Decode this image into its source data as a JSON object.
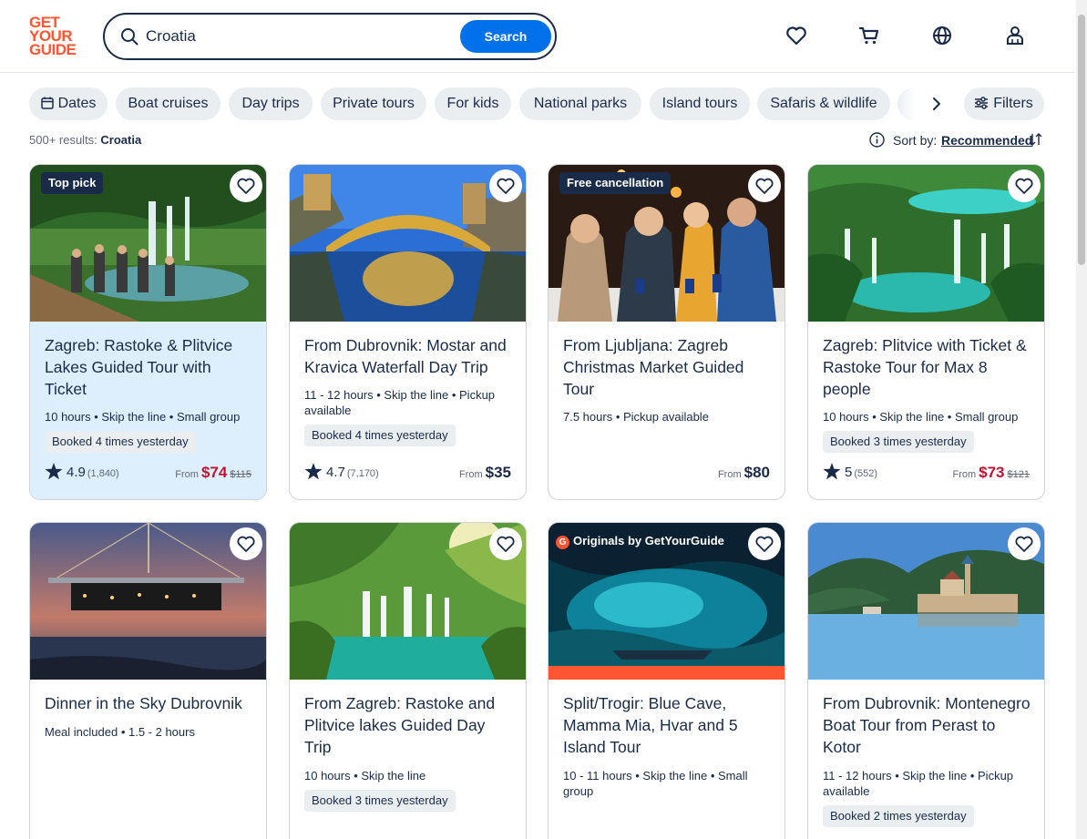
{
  "header": {
    "logo": [
      "GET",
      "YOUR",
      "GUIDE"
    ],
    "search_value": "Croatia",
    "search_button": "Search",
    "icons": [
      "heart-icon",
      "cart-icon",
      "globe-icon",
      "account-icon"
    ]
  },
  "chips": {
    "items": [
      "Dates",
      "Boat cruises",
      "Day trips",
      "Private tours",
      "For kids",
      "National parks",
      "Island tours",
      "Safaris & wildlife"
    ],
    "filters_label": "Filters"
  },
  "results": {
    "count": "500+ results:",
    "query": "Croatia",
    "sort_label": "Sort by:",
    "sort_value": "Recommended"
  },
  "colors": {
    "brand": "#ff5533",
    "primary": "#0071eb",
    "text": "#1a2b49",
    "sale": "#c4112f",
    "highlight": "#ddeefc"
  },
  "cards": [
    {
      "badge": "Top pick",
      "title": "Zagreb: Rastoke & Plitvice Lakes Guided Tour with Ticket",
      "meta": "10 hours • Skip the line • Small group",
      "booked": "Booked 4 times yesterday",
      "rating": "4.9",
      "reviews": "(1,840)",
      "price_prefix": "From",
      "price": "$74",
      "old_price": "$115"
    },
    {
      "title": "From Dubrovnik: Mostar and Kravica Waterfall Day Trip",
      "meta": "11 - 12 hours • Skip the line • Pickup available",
      "booked": "Booked 4 times yesterday",
      "rating": "4.7",
      "reviews": "(7,170)",
      "price_prefix": "From",
      "price": "$35"
    },
    {
      "badge": "Free cancellation",
      "title": "From Ljubljana: Zagreb Christmas Market Guided Tour",
      "meta": "7.5 hours • Pickup available",
      "price_prefix": "From",
      "price": "$80"
    },
    {
      "title": "Zagreb: Plitvice with Ticket & Rastoke Tour for Max 8 people",
      "meta": "10 hours • Skip the line • Small group",
      "booked": "Booked 3 times yesterday",
      "rating": "5",
      "reviews": "(552)",
      "price_prefix": "From",
      "price": "$73",
      "old_price": "$121"
    },
    {
      "title": "Dinner in the Sky Dubrovnik",
      "meta": "Meal included • 1.5 - 2 hours"
    },
    {
      "title": "From Zagreb: Rastoke and Plitvice lakes Guided Day Trip",
      "meta": "10 hours • Skip the line",
      "booked": "Booked 3 times yesterday"
    },
    {
      "originals_badge": "Originals by GetYourGuide",
      "title": "Split/Trogir: Blue Cave, Mamma Mia, Hvar and 5 Island Tour",
      "meta": "10 - 11 hours • Skip the line • Small group"
    },
    {
      "title": "From Dubrovnik: Montenegro Boat Tour from Perast to Kotor",
      "meta": "11 - 12 hours • Skip the line • Pickup available",
      "booked": "Booked 2 times yesterday"
    }
  ]
}
